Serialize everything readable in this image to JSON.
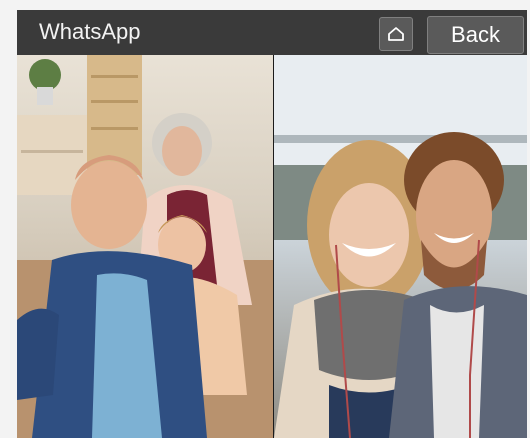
{
  "header": {
    "title": "WhatsApp",
    "back_label": "Back",
    "home_icon": "home-icon"
  },
  "video_tiles": [
    {
      "name": "participant-tile-family"
    },
    {
      "name": "participant-tile-couple"
    }
  ]
}
